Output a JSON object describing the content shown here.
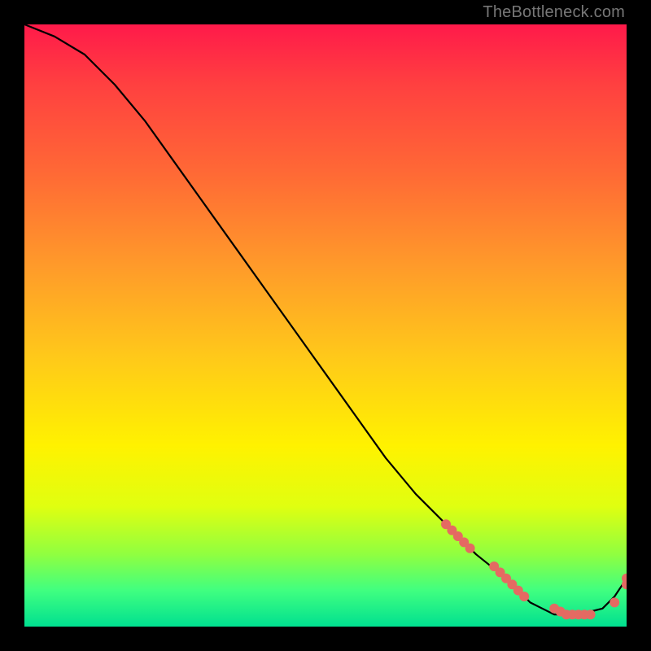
{
  "watermark": "TheBottleneck.com",
  "chart_data": {
    "type": "line",
    "title": "",
    "xlabel": "",
    "ylabel": "",
    "xlim": [
      0,
      100
    ],
    "ylim": [
      0,
      100
    ],
    "grid": false,
    "legend": false,
    "series": [
      {
        "name": "curve",
        "x": [
          0,
          5,
          10,
          15,
          20,
          25,
          30,
          35,
          40,
          45,
          50,
          55,
          60,
          65,
          70,
          75,
          80,
          82,
          84,
          86,
          88,
          90,
          92,
          94,
          96,
          98,
          100
        ],
        "y": [
          100,
          98,
          95,
          90,
          84,
          77,
          70,
          63,
          56,
          49,
          42,
          35,
          28,
          22,
          17,
          12,
          8,
          6,
          4,
          3,
          2,
          2,
          2,
          2.5,
          3,
          5,
          8
        ]
      }
    ],
    "points": {
      "name": "dots",
      "color": "#e46a62",
      "x": [
        70,
        71,
        72,
        73,
        74,
        78,
        79,
        80,
        81,
        82,
        83,
        88,
        89,
        90,
        91,
        92,
        93,
        94,
        98,
        100,
        100
      ],
      "y": [
        17,
        16,
        15,
        14,
        13,
        10,
        9,
        8,
        7,
        6,
        5,
        3,
        2.5,
        2,
        2,
        2,
        2,
        2,
        4,
        7,
        8
      ]
    }
  }
}
